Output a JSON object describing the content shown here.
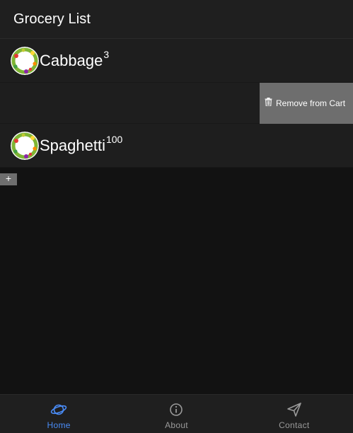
{
  "header": {
    "title": "Grocery List"
  },
  "items": [
    {
      "name": "Cabbage",
      "quantity": "3",
      "avatar_icon": "vegetable-wreath-icon"
    },
    {
      "name": "",
      "quantity": "",
      "action_label": "Remove from Cart",
      "action_icon": "trash-icon"
    },
    {
      "name": "Spaghetti",
      "quantity": "100",
      "avatar_icon": "vegetable-wreath-icon"
    }
  ],
  "add_button": {
    "label": "+"
  },
  "tabs": [
    {
      "label": "Home",
      "icon": "planet-icon",
      "active": true
    },
    {
      "label": "About",
      "icon": "info-circle-icon",
      "active": false
    },
    {
      "label": "Contact",
      "icon": "send-icon",
      "active": false
    }
  ],
  "colors": {
    "background": "#121212",
    "surface": "#1e1e1e",
    "action": "#6e6e6e",
    "accent": "#4a8cf7",
    "muted": "#9a9a9a"
  }
}
